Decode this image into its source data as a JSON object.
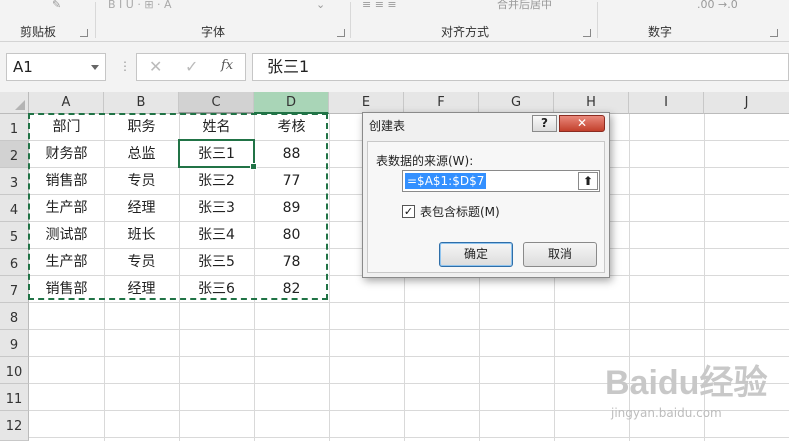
{
  "ribbon": {
    "group_labels": [
      "剪贴板",
      "字体",
      "对齐方式",
      "数字"
    ],
    "font_buttons": "B  I  U  ·  ⊞  ·  A",
    "merge_button": "合并后居中",
    "number_format_hint": ".00  →.0"
  },
  "formula_bar": {
    "name_box": "A1",
    "fx_label": "fx",
    "formula": "张三1"
  },
  "columns": [
    "A",
    "B",
    "C",
    "D",
    "E",
    "F",
    "G",
    "H",
    "I",
    "J"
  ],
  "rows": [
    "1",
    "2",
    "3",
    "4",
    "5",
    "6",
    "7",
    "8",
    "9",
    "10",
    "11",
    "12"
  ],
  "table": {
    "header": [
      "部门",
      "职务",
      "姓名",
      "考核"
    ],
    "rows": [
      [
        "财务部",
        "总监",
        "张三1",
        "88"
      ],
      [
        "销售部",
        "专员",
        "张三2",
        "77"
      ],
      [
        "生产部",
        "经理",
        "张三3",
        "89"
      ],
      [
        "测试部",
        "班长",
        "张三4",
        "80"
      ],
      [
        "生产部",
        "专员",
        "张三5",
        "78"
      ],
      [
        "销售部",
        "经理",
        "张三6",
        "82"
      ]
    ]
  },
  "dialog": {
    "title": "创建表",
    "help": "?",
    "close": "✕",
    "source_label": "表数据的来源(W):",
    "source_value": "=$A$1:$D$7",
    "collapse_icon": "⬆",
    "checkbox_checked": true,
    "checkbox_mark": "✓",
    "checkbox_label": "表包含标题(M)",
    "ok_label": "确定",
    "cancel_label": "取消"
  },
  "watermark": {
    "logo": "Baidu经验",
    "url": "jingyan.baidu.com"
  },
  "colors": {
    "accent": "#217346",
    "selected_header_fill": "#a9d5b7"
  }
}
